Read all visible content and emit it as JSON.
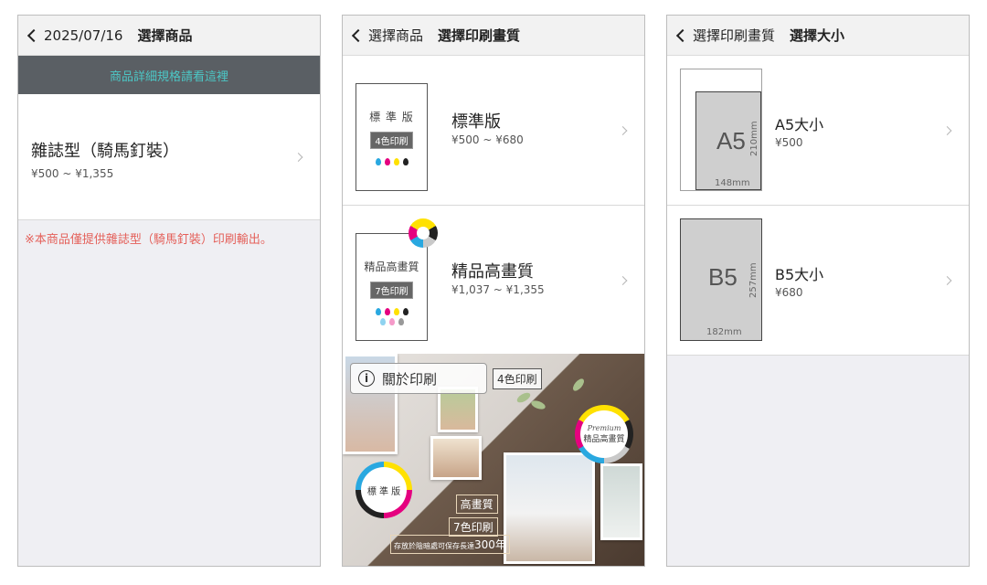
{
  "screens": [
    {
      "back_label": "2025/07/16",
      "title": "選擇商品",
      "info_bar": "商品詳細規格請看這裡",
      "product": {
        "name": "雜誌型（騎馬釘裝）",
        "price": "¥500 ~ ¥1,355"
      },
      "notice": "※本商品僅提供雜誌型（騎馬釘裝）印刷輸出。"
    },
    {
      "back_label": "選擇商品",
      "title": "選擇印刷畫質",
      "options": [
        {
          "thumb_title": "標 準 版",
          "thumb_tag": "4色印刷",
          "name": "標準版",
          "price": "¥500 ~ ¥680"
        },
        {
          "thumb_title": "精品高畫質",
          "thumb_tag": "7色印刷",
          "name": "精品高畫質",
          "price": "¥1,037 ~ ¥1,355"
        }
      ],
      "banner": {
        "about_button": "關於印刷",
        "tag_4": "4色印刷",
        "standard_circle": "標 準 版",
        "premium_script": "Premium",
        "premium_circle": "精品高畫質",
        "label_quality": "高畫質",
        "label_7": "7色印刷",
        "note_prefix": "存放於陰暗處可保存長達",
        "note_years": "300年"
      }
    },
    {
      "back_label": "選擇印刷畫質",
      "title": "選擇大小",
      "sizes": [
        {
          "letter": "A5",
          "width_dim": "148mm",
          "height_dim": "210mm",
          "name": "A5大小",
          "price": "¥500"
        },
        {
          "letter": "B5",
          "width_dim": "182mm",
          "height_dim": "257mm",
          "name": "B5大小",
          "price": "¥680"
        }
      ]
    }
  ],
  "colors": {
    "info_text": "#4cc7c6",
    "notice": "#e4605a",
    "cyan": "#29a8e0",
    "magenta": "#e5007f",
    "yellow": "#ffe100",
    "black": "#222222"
  }
}
